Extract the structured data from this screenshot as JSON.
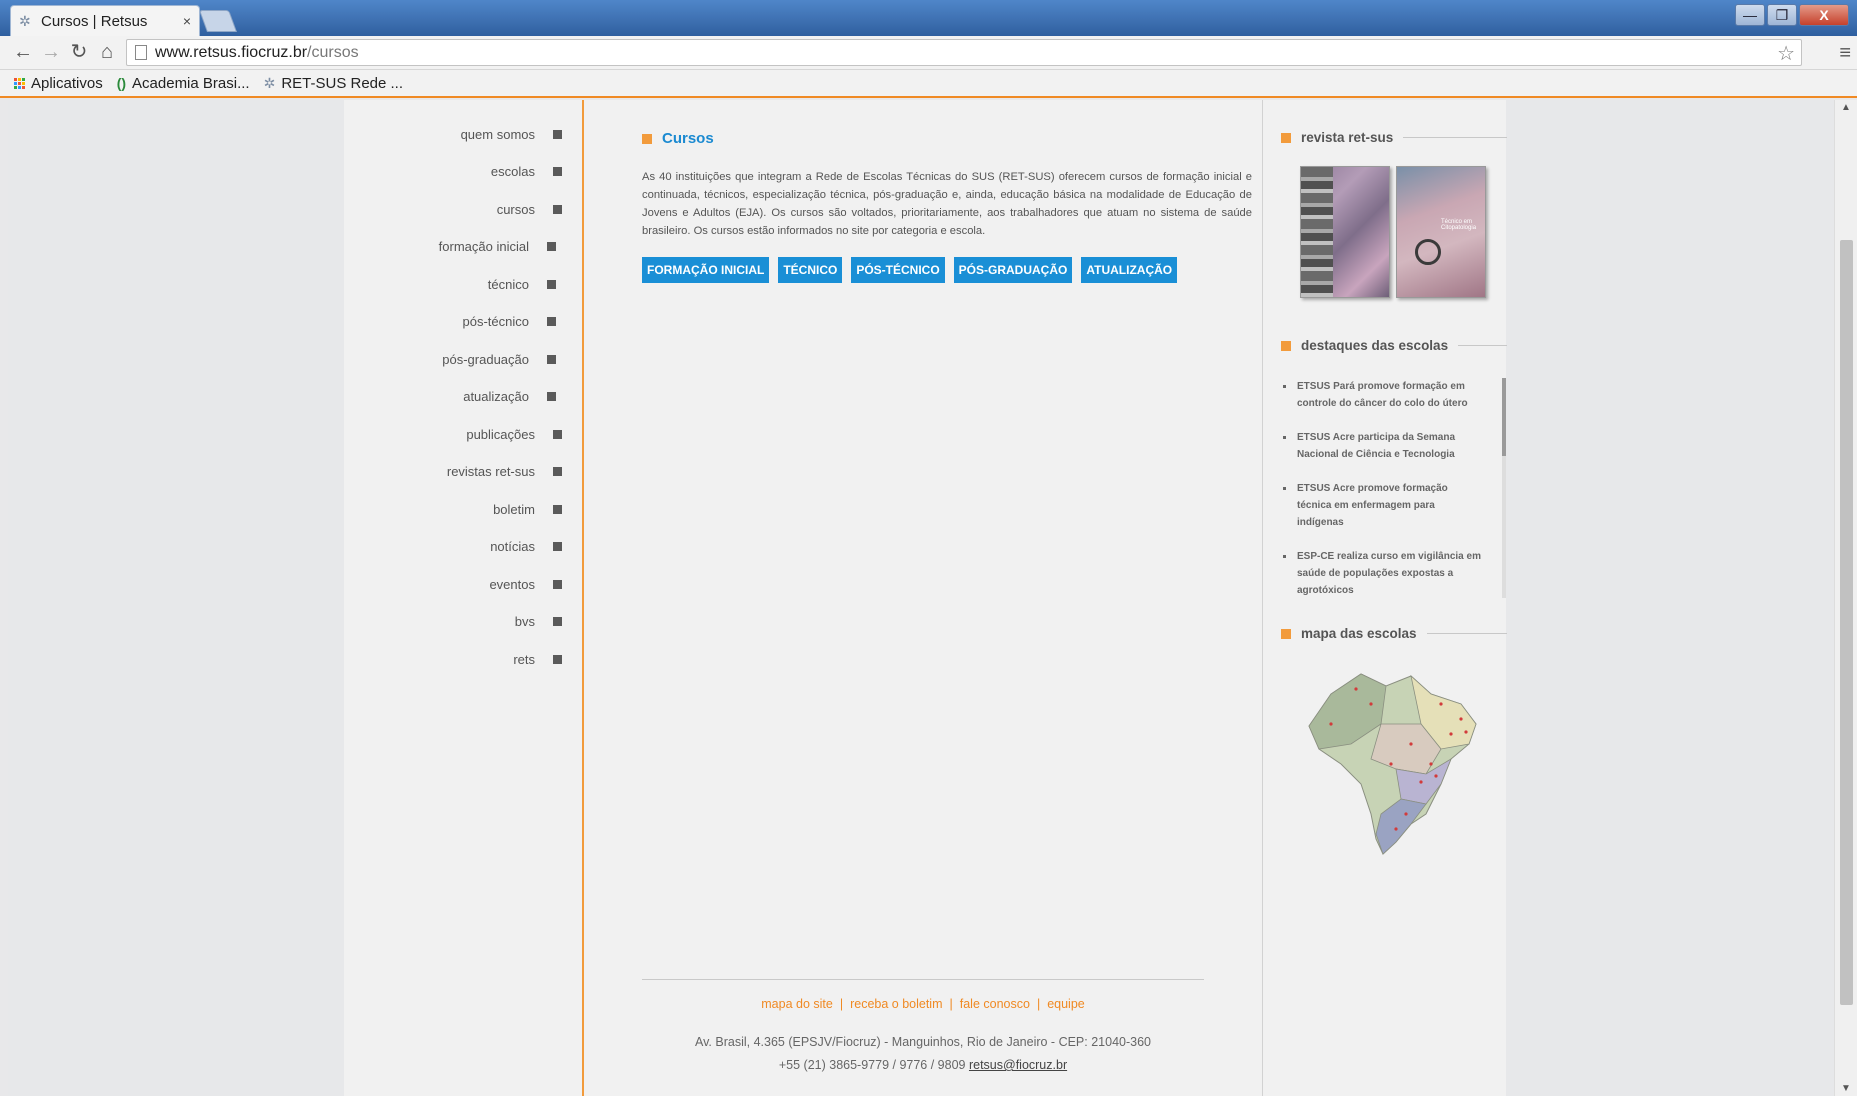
{
  "browser": {
    "tab_title": "Cursos | Retsus",
    "tab_close": "×",
    "url_host": "www.retsus.fiocruz.br",
    "url_path": "/cursos",
    "win_min": "—",
    "win_max": "❐",
    "win_close": "X",
    "bookmarks": [
      {
        "label": "Aplicativos",
        "icon": "apps-icon"
      },
      {
        "label": "Academia Brasi...",
        "icon": "academia-icon"
      },
      {
        "label": "RET-SUS Rede ...",
        "icon": "retsus-icon"
      }
    ]
  },
  "nav": {
    "items": [
      {
        "label": "quem somos",
        "level": "top"
      },
      {
        "label": "escolas",
        "level": "top"
      },
      {
        "label": "cursos",
        "level": "top"
      },
      {
        "label": "formação inicial",
        "level": "sub"
      },
      {
        "label": "técnico",
        "level": "sub"
      },
      {
        "label": "pós-técnico",
        "level": "sub"
      },
      {
        "label": "pós-graduação",
        "level": "sub"
      },
      {
        "label": "atualização",
        "level": "sub"
      },
      {
        "label": "publicações",
        "level": "top"
      },
      {
        "label": "revistas ret-sus",
        "level": "top"
      },
      {
        "label": "boletim",
        "level": "top"
      },
      {
        "label": "notícias",
        "level": "top"
      },
      {
        "label": "eventos",
        "level": "top"
      },
      {
        "label": "bvs",
        "level": "top"
      },
      {
        "label": "rets",
        "level": "top"
      }
    ]
  },
  "main": {
    "title": "Cursos",
    "text": "As 40 instituições que integram a Rede de Escolas Técnicas do SUS (RET-SUS) oferecem cursos de formação inicial e continuada, técnicos, especialização técnica, pós-graduação e, ainda, educação básica na modalidade de Educação de Jovens e Adultos (EJA). Os cursos são voltados, prioritariamente, aos trabalhadores que atuam no sistema de saúde brasileiro. Os cursos estão informados no site por categoria e escola.",
    "buttons": [
      "FORMAÇÃO INICIAL",
      "TÉCNICO",
      "PÓS-TÉCNICO",
      "PÓS-GRADUAÇÃO",
      "ATUALIZAÇÃO"
    ]
  },
  "footer": {
    "links": [
      "mapa do site",
      "receba o boletim",
      "fale conosco",
      "equipe"
    ],
    "separator": "|",
    "address": "Av. Brasil, 4.365 (EPSJV/Fiocruz) - Manguinhos, Rio de Janeiro - CEP: 21040-360",
    "phone": "+55 (21) 3865-9779 / 9776 / 9809",
    "email": "retsus@fiocruz.br"
  },
  "sidebar": {
    "revista_title": "revista ret-sus",
    "revista_cover_text": "Técnico em Citopatologia",
    "destaques_title": "destaques das escolas",
    "destaques": [
      "ETSUS Pará promove formação em controle do câncer do colo do útero",
      "ETSUS Acre participa da Semana Nacional de Ciência e Tecnologia",
      "ETSUS Acre promove formação técnica em enfermagem para indígenas",
      "ESP-CE realiza curso em vigilância em saúde de populações expostas a agrotóxicos"
    ],
    "mapa_title": "mapa das escolas"
  },
  "colors": {
    "accent_orange": "#f29b3c",
    "accent_blue": "#1a8fd6"
  }
}
